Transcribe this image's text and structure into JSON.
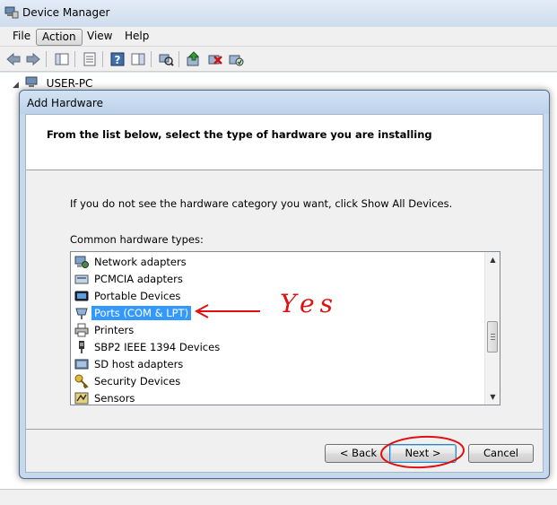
{
  "window": {
    "title": "Device Manager",
    "menu": [
      "File",
      "Action",
      "View",
      "Help"
    ],
    "tree_root": "USER-PC"
  },
  "dialog": {
    "title": "Add Hardware",
    "heading": "From the list below, select the type of hardware you are installing",
    "instruction": "If you do not see the hardware category you want, click Show All Devices.",
    "list_label": "Common hardware types:",
    "items": [
      {
        "label": "Network adapters",
        "icon": "network-adapter-icon"
      },
      {
        "label": "PCMCIA adapters",
        "icon": "pcmcia-icon"
      },
      {
        "label": "Portable Devices",
        "icon": "portable-device-icon"
      },
      {
        "label": "Ports (COM & LPT)",
        "icon": "port-icon",
        "selected": true
      },
      {
        "label": "Printers",
        "icon": "printer-icon"
      },
      {
        "label": "SBP2 IEEE 1394 Devices",
        "icon": "ieee1394-icon"
      },
      {
        "label": "SD host adapters",
        "icon": "sd-adapter-icon"
      },
      {
        "label": "Security Devices",
        "icon": "security-key-icon"
      },
      {
        "label": "Sensors",
        "icon": "sensor-icon"
      }
    ],
    "buttons": {
      "back": "< Back",
      "next": "Next >",
      "cancel": "Cancel"
    }
  },
  "annotation": {
    "text": "Yes",
    "color": "#e01010"
  },
  "colors": {
    "selection": "#3399ff",
    "dialog_frame": "#c6d8ec"
  }
}
